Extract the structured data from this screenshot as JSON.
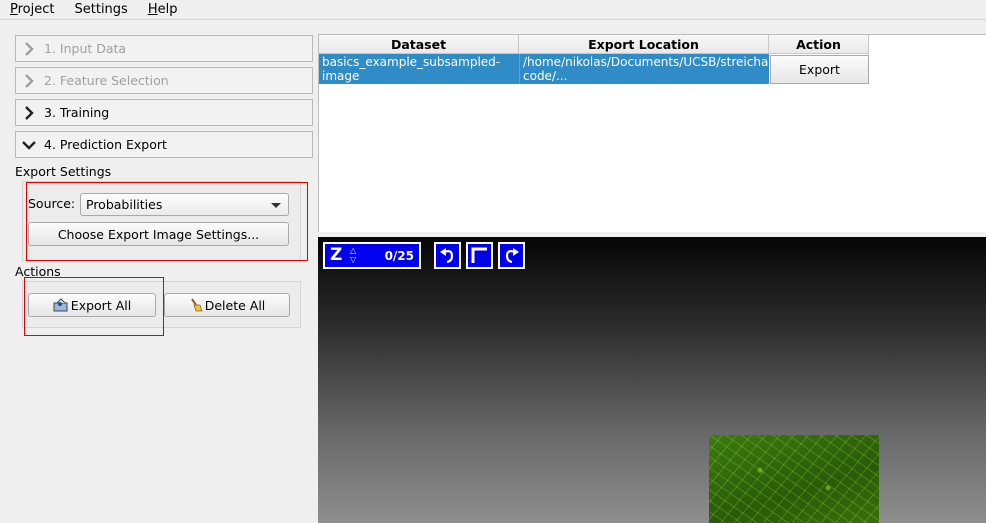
{
  "menubar": {
    "items": [
      {
        "first": "P",
        "rest": "roject"
      },
      {
        "first": "",
        "rest": "Settings"
      },
      {
        "first": "H",
        "rest": "elp"
      }
    ]
  },
  "applets": [
    {
      "label": "1. Input Data",
      "expanded": false,
      "enabled": false
    },
    {
      "label": "2. Feature Selection",
      "expanded": false,
      "enabled": false
    },
    {
      "label": "3. Training",
      "expanded": false,
      "enabled": true
    },
    {
      "label": "4. Prediction Export",
      "expanded": true,
      "enabled": true
    }
  ],
  "export_settings": {
    "title": "Export Settings",
    "source_label": "Source:",
    "source_value": "Probabilities",
    "choose_button": "Choose Export Image Settings..."
  },
  "actions": {
    "title": "Actions",
    "export_all": "Export All",
    "delete_all": "Delete All"
  },
  "table": {
    "headers": [
      "Dataset",
      "Export Location",
      "Action"
    ],
    "rows": [
      {
        "dataset": "basics_example_subsampled-image",
        "location": "/home/nikolas/Documents/UCSB/streichan/numerics/code/python code/...",
        "action": "Export"
      }
    ]
  },
  "viewer": {
    "axis": "Z",
    "slice": "0/25"
  },
  "colors": {
    "selection": "#308cc6",
    "viewer_controls": "#0000ee",
    "highlight": "#e00000"
  }
}
